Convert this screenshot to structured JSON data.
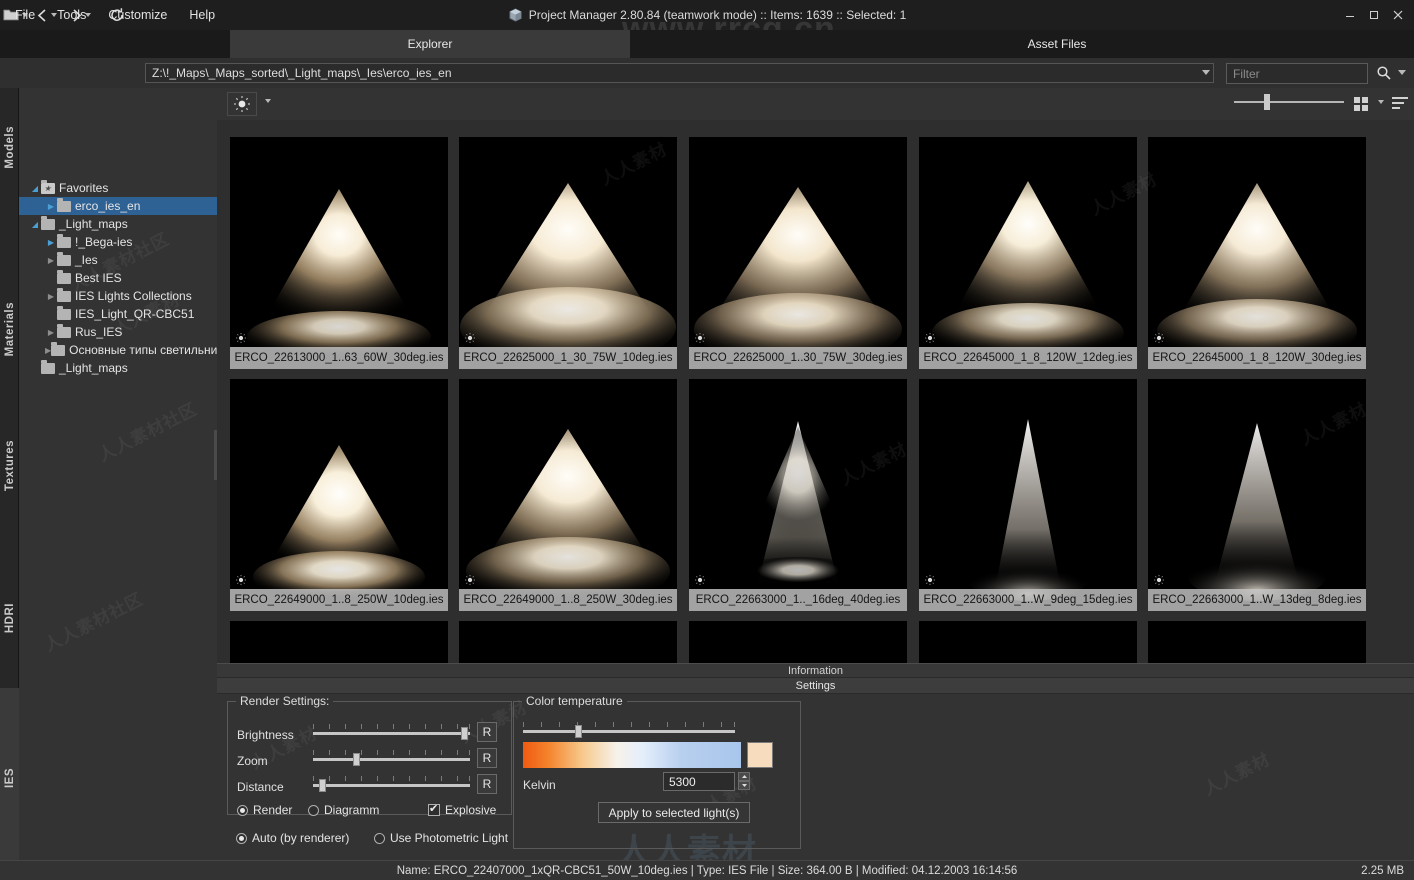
{
  "window": {
    "title": "Project Manager 2.80.84 (teamwork mode)  :: Items: 1639  :: Selected: 1",
    "app_icon": "cube-icon",
    "minimize": "–",
    "maximize": "❐",
    "close": "✕"
  },
  "menubar": {
    "items": [
      {
        "label": "File"
      },
      {
        "label": "Tools"
      },
      {
        "label": "Customize"
      },
      {
        "label": "Help"
      }
    ]
  },
  "top_tabs": [
    {
      "label": "Explorer",
      "active": true
    },
    {
      "label": "Asset Files",
      "active": false
    }
  ],
  "navbar": {
    "open_icon": "open-folder-icon",
    "back_icon": "back-arrow-icon",
    "forward_icon": "forward-arrow-icon",
    "refresh_icon": "refresh-icon",
    "address": "Z:\\!_Maps\\_Maps_sorted\\_Light_maps\\_Ies\\erco_ies_en",
    "filter_placeholder": "Filter",
    "filter_value": "",
    "search_icon": "search-icon"
  },
  "side_tabs": [
    {
      "label": "Models",
      "active": false
    },
    {
      "label": "Materials",
      "active": false
    },
    {
      "label": "Textures",
      "active": false
    },
    {
      "label": "HDRI",
      "active": false
    },
    {
      "label": "IES",
      "active": true
    }
  ],
  "side_tabs_star": "★",
  "tree": [
    {
      "label": "Favorites",
      "indent": 0,
      "expander": "open",
      "icon": "favorites-folder-icon",
      "selected": false
    },
    {
      "label": "erco_ies_en",
      "indent": 1,
      "expander": "closed",
      "icon": "folder-icon",
      "selected": true
    },
    {
      "label": "_Light_maps",
      "indent": 0,
      "expander": "open",
      "icon": "folder-icon",
      "selected": false
    },
    {
      "label": "!_Bega-ies",
      "indent": 1,
      "expander": "closed",
      "icon": "folder-icon",
      "selected": false
    },
    {
      "label": "_Ies",
      "indent": 1,
      "expander": "closed",
      "icon": "folder-icon",
      "selected": false
    },
    {
      "label": "Best IES",
      "indent": 1,
      "expander": "none",
      "icon": "folder-icon",
      "selected": false
    },
    {
      "label": "IES Lights Collections",
      "indent": 1,
      "expander": "closed",
      "icon": "folder-icon",
      "selected": false
    },
    {
      "label": "IES_Light_QR-CBC51",
      "indent": 1,
      "expander": "none",
      "icon": "folder-icon",
      "selected": false
    },
    {
      "label": "Rus_IES",
      "indent": 1,
      "expander": "closed",
      "icon": "folder-icon",
      "selected": false
    },
    {
      "label": "Основные типы светильни",
      "indent": 1,
      "expander": "closed",
      "icon": "folder-icon",
      "selected": false
    },
    {
      "label": "_Light_maps",
      "indent": 0,
      "expander": "none",
      "icon": "folder-icon",
      "selected": false
    }
  ],
  "thumb_toolbar": {
    "bulb_icon": "lightbulb-icon",
    "bulb_caret": "chevron-down-icon",
    "zoom_slider_value": 28,
    "grid_view_icon": "grid-view-icon",
    "sort_icon": "sort-icon"
  },
  "thumbnails": [
    {
      "label": "ERCO_22613000_1..63_60W_30deg.ies",
      "beam": "wide",
      "bulb": "lightbulb-icon"
    },
    {
      "label": "ERCO_22625000_1_30_75W_10deg.ies",
      "beam": "broad",
      "bulb": "lightbulb-icon"
    },
    {
      "label": "ERCO_22625000_1..30_75W_30deg.ies",
      "beam": "broad",
      "bulb": "lightbulb-icon"
    },
    {
      "label": "ERCO_22645000_1_8_120W_12deg.ies",
      "beam": "wide",
      "bulb": "lightbulb-icon"
    },
    {
      "label": "ERCO_22645000_1_8_120W_30deg.ies",
      "beam": "wide",
      "bulb": "lightbulb-icon"
    },
    {
      "label": "ERCO_22649000_1..8_250W_10deg.ies",
      "beam": "wide",
      "bulb": "lightbulb-icon"
    },
    {
      "label": "ERCO_22649000_1..8_250W_30deg.ies",
      "beam": "broad",
      "bulb": "lightbulb-icon"
    },
    {
      "label": "ERCO_22663000_1.._16deg_40deg.ies",
      "beam": "narrow",
      "bulb": "lightbulb-icon"
    },
    {
      "label": "ERCO_22663000_1..W_9deg_15deg.ies",
      "beam": "narrow",
      "bulb": "lightbulb-icon"
    },
    {
      "label": "ERCO_22663000_1..W_13deg_8deg.ies",
      "beam": "narrow",
      "bulb": "lightbulb-icon"
    }
  ],
  "bottom_tabs": {
    "information": "Information",
    "settings": "Settings"
  },
  "render_settings": {
    "legend": "Render Settings:",
    "sliders": [
      {
        "label": "Brightness",
        "value": 96,
        "reset_label": "R"
      },
      {
        "label": "Zoom",
        "value": 26,
        "reset_label": "R"
      },
      {
        "label": "Distance",
        "value": 5,
        "reset_label": "R"
      }
    ],
    "mode_options": [
      {
        "label": "Render",
        "selected": true
      },
      {
        "label": "Diagramm",
        "selected": false
      }
    ],
    "explosive": {
      "label": "Explosive",
      "checked": true
    },
    "light_options": [
      {
        "label": "Auto (by renderer)",
        "selected": true
      },
      {
        "label": "Use Photometric Light",
        "selected": false
      }
    ]
  },
  "color_temperature": {
    "legend": "Color temperature",
    "slider_value": 28,
    "kelvin_label": "Kelvin",
    "kelvin_value": "5300",
    "swatch_color": "#f7ddbe",
    "apply_label": "Apply to selected light(s)",
    "spin_up": "▲",
    "spin_down": "▼"
  },
  "statusbar": {
    "info": "Name: ERCO_22407000_1xQR-CBC51_50W_10deg.ies | Type: IES File | Size: 364.00 B | Modified: 04.12.2003 16:14:56",
    "size": "2.25 MB"
  },
  "watermarks": {
    "site": "www.rrcg.cn",
    "brand": "人人素材",
    "diag": "人人素材社区"
  }
}
